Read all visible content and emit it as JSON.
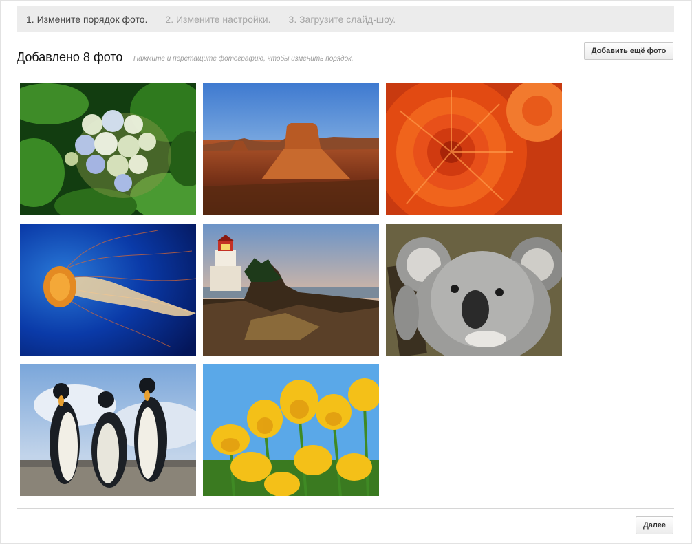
{
  "steps": [
    {
      "label": "1. Измените порядок фото.",
      "active": true
    },
    {
      "label": "2. Измените настройки.",
      "active": false
    },
    {
      "label": "3. Загрузите слайд-шоу.",
      "active": false
    }
  ],
  "header": {
    "title": "Добавлено 8 фото",
    "hint": "Нажмите и перетащите фотографию, чтобы изменить порядок.",
    "add_button_label": "Добавить ещё фото"
  },
  "photos": [
    {
      "subject": "hydrangea"
    },
    {
      "subject": "desert"
    },
    {
      "subject": "chrysanthemum"
    },
    {
      "subject": "jellyfish"
    },
    {
      "subject": "lighthouse"
    },
    {
      "subject": "koala"
    },
    {
      "subject": "penguins"
    },
    {
      "subject": "tulips"
    }
  ],
  "footer": {
    "next_button_label": "Далее"
  }
}
